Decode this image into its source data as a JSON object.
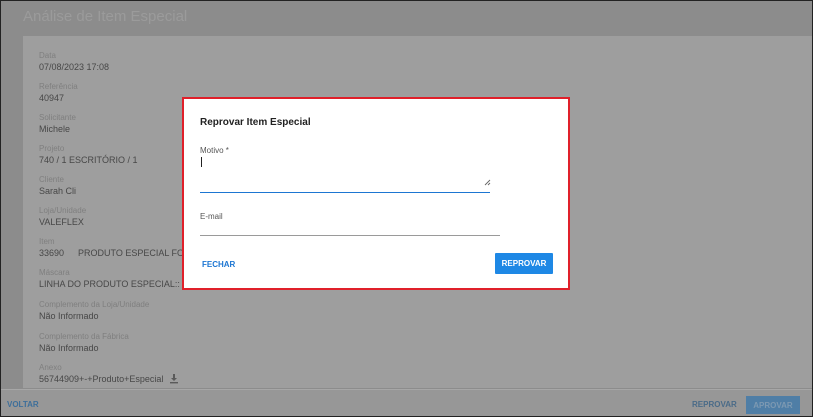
{
  "page": {
    "title": "Análise de Item Especial"
  },
  "fields": [
    {
      "label": "Data",
      "value": "07/08/2023 17:08"
    },
    {
      "label": "Referência",
      "value": "40947"
    },
    {
      "label": "Solicitante",
      "value": "Michele"
    },
    {
      "label": "Projeto",
      "value": "740 / 1 ESCRITÓRIO / 1"
    },
    {
      "label": "Cliente",
      "value": "Sarah Cli"
    },
    {
      "label": "Loja/Unidade",
      "value": "VALEFLEX"
    },
    {
      "label": "Item",
      "code": "33690",
      "value": "PRODUTO ESPECIAL FOCC"
    },
    {
      "label": "Máscara",
      "value": "LINHA DO PRODUTO ESPECIAL:: ESP"
    },
    {
      "label": "Complemento da Loja/Unidade",
      "value": "Não Informado"
    },
    {
      "label": "Complemento da Fábrica",
      "value": "Não Informado"
    },
    {
      "label": "Anexo",
      "value": "56744909+-+Produto+Especial",
      "icon": "download-icon"
    }
  ],
  "footer": {
    "voltar_label": "VOLTAR",
    "reprovar_label": "REPROVAR",
    "aprovar_label": "APROVAR"
  },
  "dialog": {
    "title": "Reprovar Item Especial",
    "motivo_label": "Motivo *",
    "motivo_value": "",
    "email_label": "E-mail",
    "email_value": "",
    "fechar_label": "FECHAR",
    "reprovar_label": "REPROVAR",
    "highlight_color": "#e0202a",
    "accent_color": "#1e88e5"
  }
}
